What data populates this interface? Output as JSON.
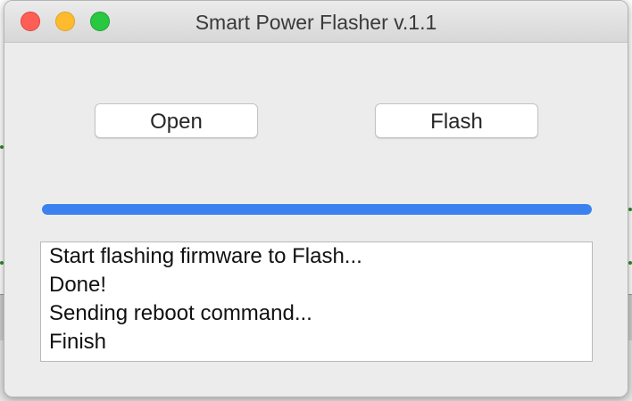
{
  "window": {
    "title": "Smart Power Flasher v.1.1"
  },
  "buttons": {
    "open_label": "Open",
    "flash_label": "Flash"
  },
  "progress": {
    "fraction": 1.0,
    "color": "#3b82f0"
  },
  "log": {
    "lines": [
      "Start flashing firmware to Flash...",
      "Done!",
      "Sending reboot command...",
      "Finish"
    ]
  }
}
